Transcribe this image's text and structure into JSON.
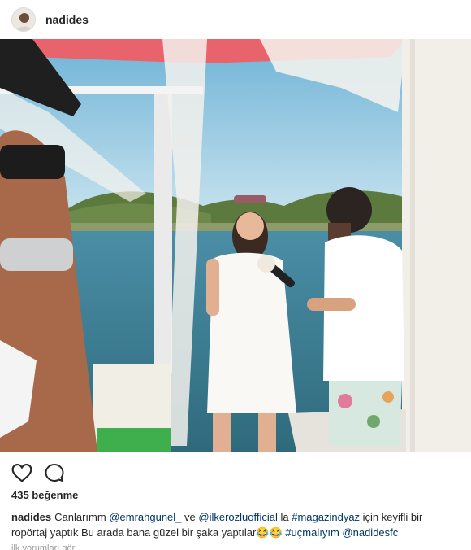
{
  "post": {
    "username": "nadides",
    "avatar_icon": "profile-avatar",
    "likes_text": "435 beğenme",
    "caption": {
      "username": "nadides",
      "segments": [
        {
          "text": "Canlarımm ",
          "type": "text"
        },
        {
          "text": "@emrahgunel_",
          "type": "mention"
        },
        {
          "text": " ve ",
          "type": "text"
        },
        {
          "text": "@ilkerozluofficial",
          "type": "mention"
        },
        {
          "text": " la ",
          "type": "text"
        },
        {
          "text": "#magazindyaz",
          "type": "tag"
        },
        {
          "text": " için keyifli bir ropörtaj yaptık Bu arada bana güzel bir şaka yaptılar😂😂 ",
          "type": "text"
        },
        {
          "text": "#uçmalıyım",
          "type": "tag"
        },
        {
          "text": " ",
          "type": "text"
        },
        {
          "text": "@nadidesfc",
          "type": "mention"
        }
      ]
    },
    "more_text": "ilk yorumları gör"
  },
  "actions": {
    "like_icon": "heart-icon",
    "comment_icon": "comment-icon"
  },
  "colors": {
    "link": "#003569",
    "text": "#262626",
    "sea": "#3d7f94",
    "sky": "#bfe0ee"
  }
}
